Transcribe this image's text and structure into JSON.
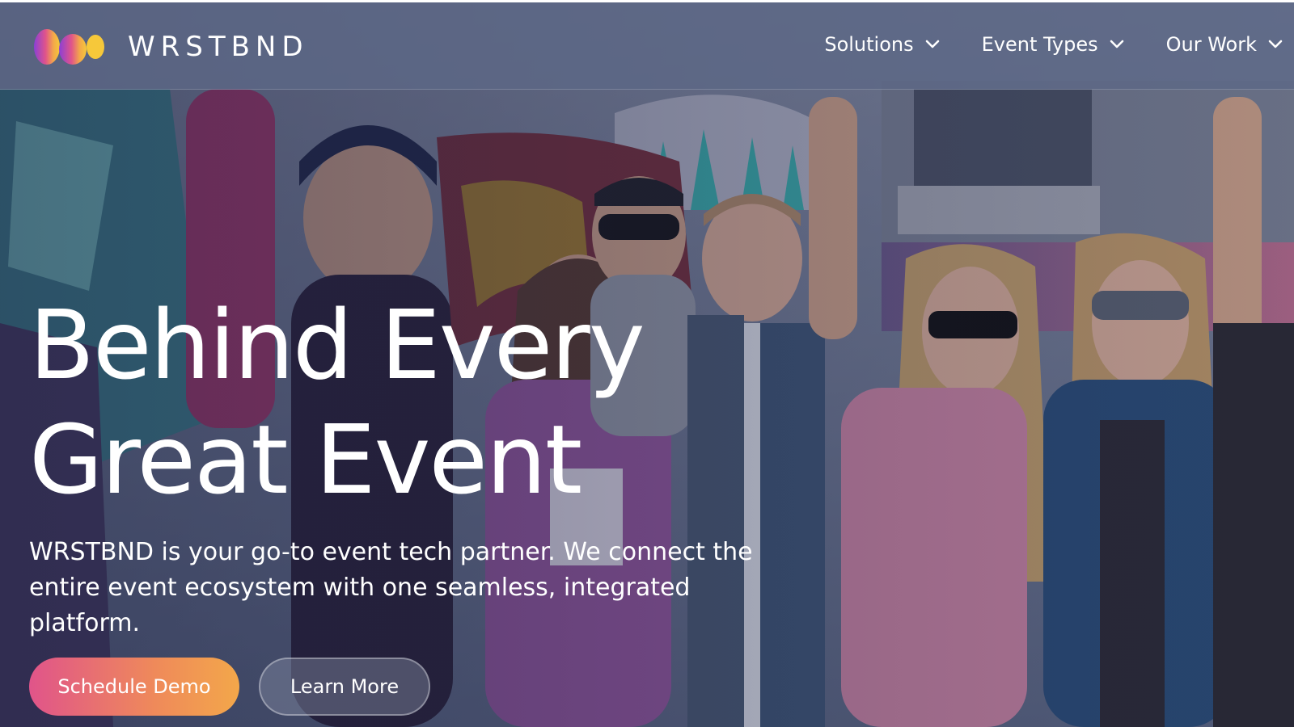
{
  "brand": {
    "name": "WRSTBND",
    "logo_icon": "wrstbnd-logo-icon",
    "logo_colors": [
      "#8b3fd6",
      "#e0548a",
      "#f3a74a",
      "#f6c83a"
    ]
  },
  "nav": {
    "items": [
      {
        "label": "Solutions",
        "icon": "chevron-down-icon"
      },
      {
        "label": "Event Types",
        "icon": "chevron-down-icon"
      },
      {
        "label": "Our Work",
        "icon": "chevron-down-icon"
      }
    ]
  },
  "hero": {
    "title_line1": "Behind Every",
    "title_line2": "Great Event",
    "subtitle": "WRSTBND is your go-to event tech partner. We connect the entire event ecosystem with one seamless, integrated platform.",
    "primary_cta": "Schedule Demo",
    "secondary_cta": "Learn More",
    "accent_gradient": [
      "#e0548a",
      "#f3a74a"
    ]
  }
}
